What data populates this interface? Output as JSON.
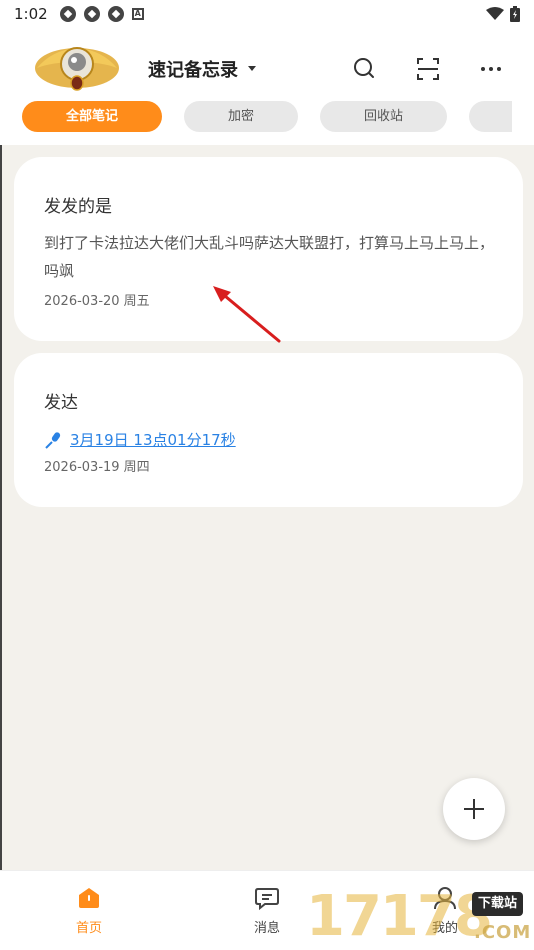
{
  "status_bar": {
    "time": "1:02",
    "left_icons": [
      "notification-icon",
      "notification-icon",
      "notification-icon",
      "a-icon"
    ],
    "right_icons": [
      "wifi-icon",
      "battery-icon"
    ]
  },
  "header": {
    "title": "速记备忘录",
    "actions": [
      "search-icon",
      "scan-icon",
      "more-icon"
    ]
  },
  "tabs": [
    {
      "label": "全部笔记",
      "active": true
    },
    {
      "label": "加密",
      "active": false
    },
    {
      "label": "回收站",
      "active": false
    },
    {
      "label": "",
      "active": false
    }
  ],
  "notes": [
    {
      "title": "发发的是",
      "body": "到打了卡法拉达大佬们大乱斗吗萨达大联盟打，打算马上马上马上， 吗飒",
      "date": "2026-03-20 周五"
    },
    {
      "title": "发达",
      "voice_label": "3月19日 13点01分17秒",
      "date": "2026-03-19 周四"
    }
  ],
  "bottom_nav": [
    {
      "label": "首页",
      "icon": "home-icon",
      "active": true
    },
    {
      "label": "消息",
      "icon": "message-icon",
      "active": false
    },
    {
      "label": "我的",
      "icon": "profile-icon",
      "active": false
    }
  ],
  "watermark": {
    "digits": "17178",
    "badge": "下载站",
    "suffix": ".COM"
  },
  "colors": {
    "accent": "#ff8c1a",
    "link": "#2a82e4",
    "content_bg": "#f3f1ec",
    "tab_bg": "#e8e8e8"
  }
}
